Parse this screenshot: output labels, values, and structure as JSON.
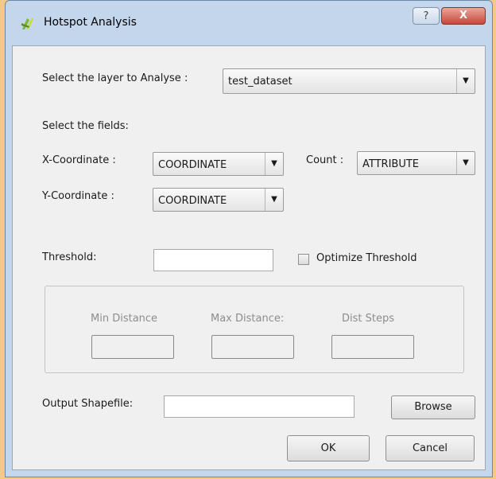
{
  "window": {
    "title": "Hotspot Analysis",
    "help_glyph": "?",
    "close_glyph": "X"
  },
  "layer": {
    "label": "Select the layer to Analyse :",
    "selected": "test_dataset",
    "arrow": "▼"
  },
  "fields": {
    "heading": "Select the fields:",
    "x_label": "X-Coordinate :",
    "x_value": "COORDINATE",
    "y_label": "Y-Coordinate :",
    "y_value": "COORDINATE",
    "count_label": "Count :",
    "count_value": "ATTRIBUTE"
  },
  "threshold": {
    "label": "Threshold:",
    "value": "",
    "optimize_label": "Optimize Threshold",
    "optimize_checked": false
  },
  "distances": {
    "min_label": "Min Distance",
    "max_label": "Max Distance:",
    "steps_label": "Dist Steps"
  },
  "output": {
    "label": "Output Shapefile:",
    "value": "",
    "browse_label": "Browse"
  },
  "footer": {
    "ok_label": "OK",
    "cancel_label": "Cancel"
  }
}
